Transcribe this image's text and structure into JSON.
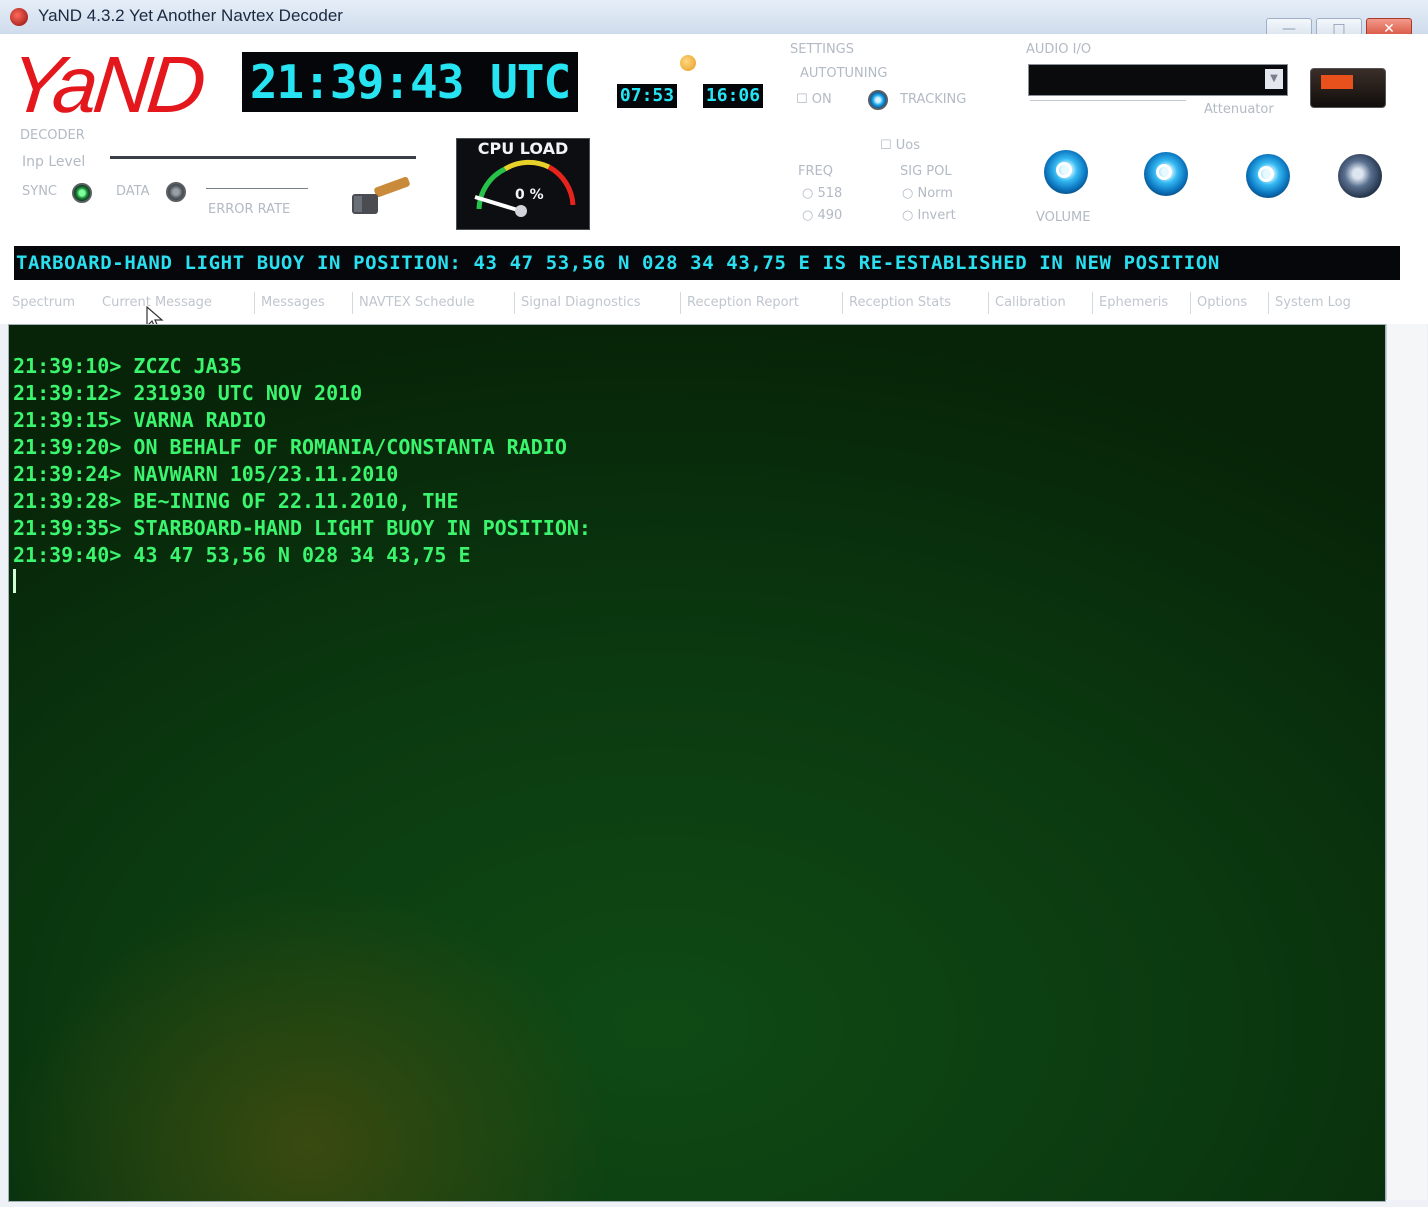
{
  "window": {
    "title": "YaND 4.3.2 Yet Another Navtex Decoder",
    "minimize_label": "—",
    "maximize_label": "□",
    "close_label": "✕"
  },
  "header": {
    "logo_text": "YaND",
    "utc_clock": "21:39:43 UTC",
    "sunrise": "07:53",
    "sunset": "16:06"
  },
  "decoder": {
    "section_label": "DECODER",
    "inp_level_label": "Inp Level",
    "sync_label": "SYNC",
    "data_label": "DATA",
    "error_rate_label": "ERROR RATE"
  },
  "cpu": {
    "title": "CPU LOAD",
    "value": "0 %"
  },
  "settings": {
    "section_label": "SETTINGS",
    "autotuning_label": "AUTOTUNING",
    "on_label": "ON",
    "tracking_label": "TRACKING",
    "uos_label": "Uos",
    "freq_label": "FREQ",
    "sig_pol_label": "SIG POL",
    "freq_518": "518",
    "freq_490": "490",
    "norm_label": "Norm",
    "invert_label": "Invert"
  },
  "audio": {
    "section_label": "AUDIO I/O",
    "attenuator_label": "Attenuator",
    "volume_label": "VOLUME"
  },
  "ticker": {
    "text": "TARBOARD-HAND LIGHT BUOY IN POSITION: 43 47 53,56 N 028 34 43,75 E IS RE-ESTABLISHED IN NEW POSITION"
  },
  "tabs": [
    "Spectrum",
    "Current Message",
    "Messages",
    "NAVTEX Schedule",
    "Signal Diagnostics",
    "Reception Report",
    "Reception Stats",
    "Calibration",
    "Ephemeris",
    "Options",
    "System Log"
  ],
  "console": {
    "lines": [
      "21:39:10> ZCZC JA35",
      "21:39:12> 231930 UTC NOV 2010",
      "21:39:15> VARNA RADIO",
      "21:39:20> ON BEHALF OF ROMANIA/CONSTANTA RADIO",
      "21:39:24> NAVWARN 105/23.11.2010",
      "21:39:28> BE~INING OF 22.11.2010, THE",
      "21:39:35> STARBOARD-HAND LIGHT BUOY IN POSITION:",
      "21:39:40> 43 47 53,56 N 028 34 43,75 E"
    ]
  },
  "colors": {
    "clock_text": "#27e4f2",
    "console_text": "#3cf56e",
    "logo": "#e3171c",
    "console_bg": "#0b3a10"
  }
}
